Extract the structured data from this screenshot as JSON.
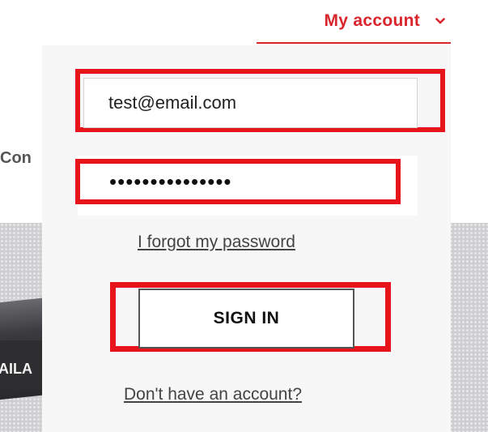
{
  "background": {
    "partial_text": "Con",
    "banner_partial_label": "AILA"
  },
  "header": {
    "account_label": "My account",
    "chevron_icon": "chevron-down-icon",
    "accent_color": "#d9242b"
  },
  "login_form": {
    "email_value": "test@email.com",
    "password_masked": "•••••••••••••••",
    "forgot_password_label": "I forgot my password",
    "sign_in_label": "SIGN IN",
    "register_label": "Don't have an account?"
  },
  "highlight_color": "#e8141c"
}
